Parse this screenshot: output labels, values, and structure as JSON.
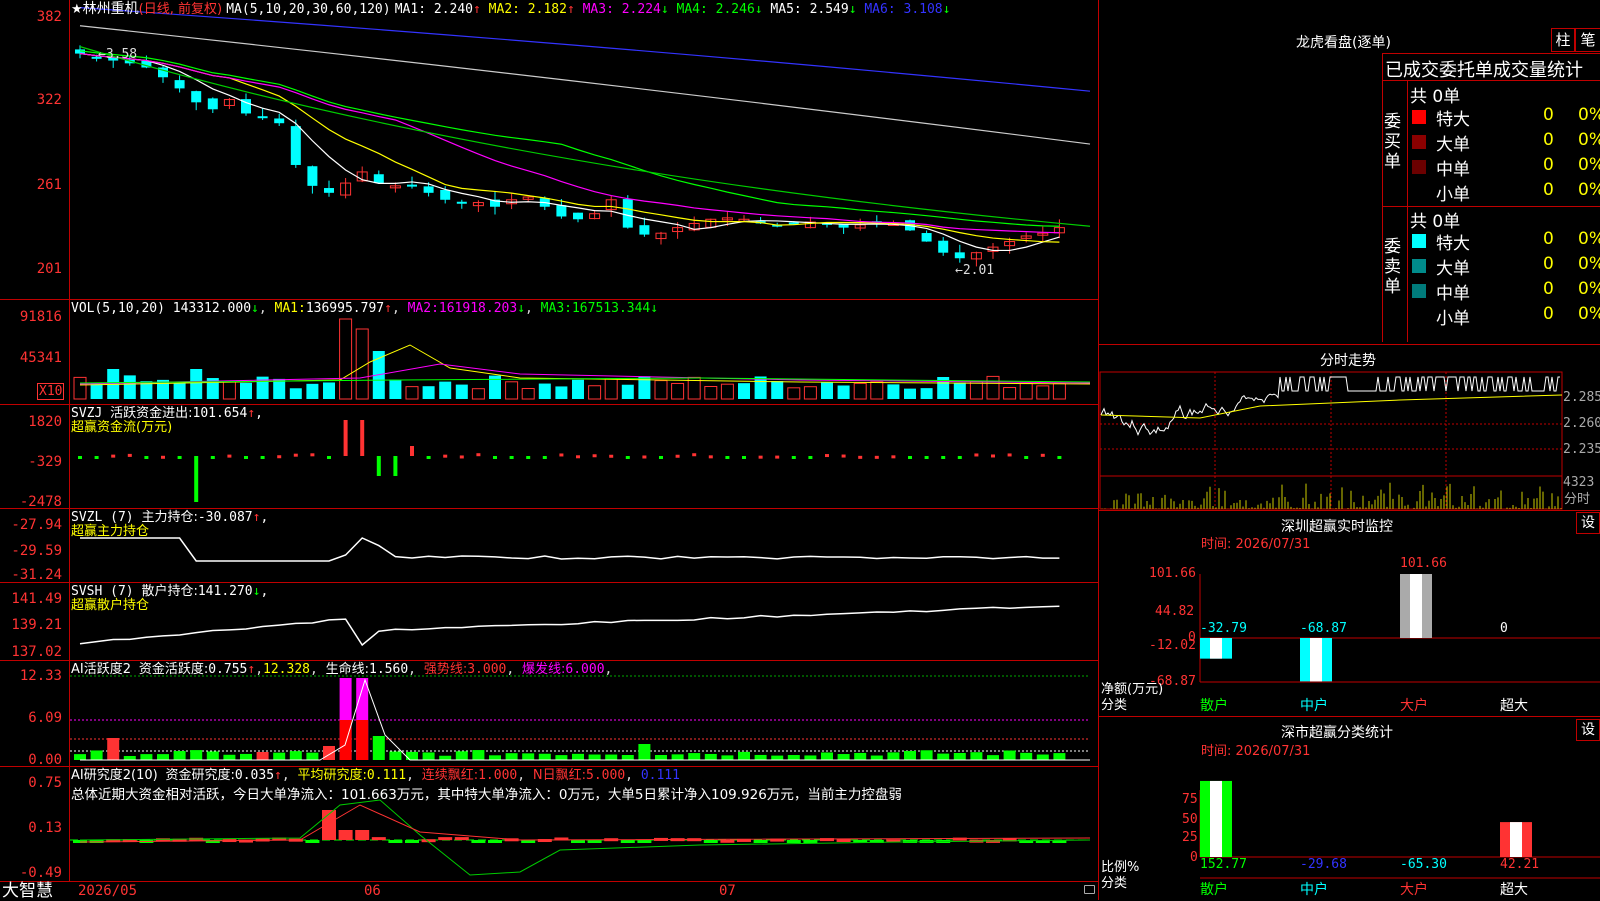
{
  "header": {
    "star": "★",
    "stock_name": "林州重机",
    "mode": "(日线, 前复权)",
    "ma_params": "MA(5,10,20,30,60,120)",
    "ma": [
      {
        "label": "MA1:",
        "value": "2.240",
        "arrow": "↑",
        "color": "#ffffff"
      },
      {
        "label": "MA2:",
        "value": "2.182",
        "arrow": "↑",
        "color": "#ffff00"
      },
      {
        "label": "MA3:",
        "value": "2.224",
        "arrow": "↓",
        "color": "#ff00ff"
      },
      {
        "label": "MA4:",
        "value": "2.246",
        "arrow": "↓",
        "color": "#00ff00"
      },
      {
        "label": "MA5:",
        "value": "2.549",
        "arrow": "↓",
        "color": "#ffffff"
      },
      {
        "label": "MA6:",
        "value": "3.108",
        "arrow": "↓",
        "color": "#3333ff"
      }
    ]
  },
  "price_axis": [
    "382",
    "322",
    "261",
    "201"
  ],
  "price_marks": {
    "high": "3.58",
    "low": "2.01"
  },
  "vol_panel": {
    "params": "VOL(5,10,20)",
    "vol": "143312.000",
    "vol_arrow": "↓",
    "ma1_label": "MA1:",
    "ma1": "136995.797",
    "ma1_arrow": "↑",
    "ma2_label": "MA2:",
    "ma2": "161918.203",
    "ma2_arrow": "↓",
    "ma3_label": "MA3:",
    "ma3": "167513.344",
    "ma3_arrow": "↓",
    "axis": [
      "91816",
      "45341"
    ],
    "unit": "X10"
  },
  "svzj_panel": {
    "name": "SVZJ",
    "label": "活跃资金进出:",
    "value": "101.654",
    "arrow": "↑",
    "comma": ",",
    "subtitle": "超赢资金流(万元)",
    "axis": [
      "1820",
      "-329",
      "-2478"
    ]
  },
  "svzl_panel": {
    "name": "SVZL",
    "param": "(7)",
    "label": "主力持仓:",
    "value": "-30.087",
    "arrow": "↑",
    "comma": ",",
    "subtitle": "超赢主力持仓",
    "axis": [
      "-27.94",
      "-29.59",
      "-31.24"
    ]
  },
  "svsh_panel": {
    "name": "SVSH",
    "param": "(7)",
    "label": "散户持仓:",
    "value": "141.270",
    "arrow": "↓",
    "comma": ",",
    "subtitle": "超赢散户持仓",
    "axis": [
      "141.49",
      "139.21",
      "137.02"
    ]
  },
  "ai_active_panel": {
    "name": "AI活跃度2",
    "label": "资金活跃度:",
    "value": "0.755",
    "arrow": "↑",
    "value2": "12.328",
    "life_label": "生命线:",
    "life_value": "1.560",
    "strong_label": "强势线:",
    "strong_value": "3.000",
    "burst_label": "爆发线:",
    "burst_value": "6.000",
    "axis": [
      "12.33",
      "6.09",
      "0.00"
    ]
  },
  "ai_research_panel": {
    "name": "AI研究度2(10)",
    "label": "资金研究度:",
    "value": "0.035",
    "arrow": "↑",
    "avg_label": "平均研究度:",
    "avg_value": "0.111",
    "cont_label": "连续飘红:",
    "cont_value": "1.000",
    "nday_label": "N日飘红:",
    "nday_value": "5.000",
    "last_value": "0.111",
    "summary": "总体近期大资金相对活跃，今日大单净流入：101.663万元，其中特大单净流入：0万元，大单5日累计净入109.926万元，当前主力控盘弱",
    "axis": [
      "0.75",
      "0.13",
      "-0.49"
    ]
  },
  "bottom_bar": {
    "brand": "大智慧",
    "dates": [
      "2026/05",
      "06",
      "07"
    ]
  },
  "right_panel": {
    "dragon_tiger_title": "龙虎看盘(逐单)",
    "btn_column": "柱",
    "btn_brush": "笔",
    "table_title": "已成交委托单成交量统计",
    "buy_label": "委买单",
    "sell_label": "委卖单",
    "buy_total": "共 0单",
    "sell_total": "共 0单",
    "buy_rows": [
      {
        "name": "特大",
        "count": "0",
        "pct": "0%",
        "color": "#ff0000"
      },
      {
        "name": "大单",
        "count": "0",
        "pct": "0%",
        "color": "#8b0000"
      },
      {
        "name": "中单",
        "count": "0",
        "pct": "0%",
        "color": "#6b0000"
      },
      {
        "name": "小单",
        "count": "0",
        "pct": "0%",
        "color": "#000000"
      }
    ],
    "sell_rows": [
      {
        "name": "特大",
        "count": "0",
        "pct": "0%",
        "color": "#00ffff"
      },
      {
        "name": "大单",
        "count": "0",
        "pct": "0%",
        "color": "#008b8b"
      },
      {
        "name": "中单",
        "count": "0",
        "pct": "0%",
        "color": "#007b7b"
      },
      {
        "name": "小单",
        "count": "0",
        "pct": "0%",
        "color": "#000000"
      }
    ],
    "intraday_title": "分时走势",
    "intraday_axis": [
      "2.285",
      "2.260",
      "2.235"
    ],
    "intraday_vol": "4323",
    "intraday_unit": "分时",
    "sz_monitor_title": "深圳超赢实时监控",
    "set_label": "设",
    "sz_time": "时间: 2026/07/31",
    "sz_axis": [
      "101.66",
      "44.82",
      "0",
      "-12.02",
      "-68.87"
    ],
    "sz_net_label": "净额(万元)",
    "sz_class_label": "分类",
    "sz_values": [
      "-32.79",
      "-68.87",
      "101.66",
      "0"
    ],
    "sz_categories": [
      "散户",
      "中户",
      "大户",
      "超大"
    ],
    "sz_stat_title": "深市超赢分类统计",
    "sz_stat_time": "时间: 2026/07/31",
    "sz_stat_axis": [
      "75",
      "50",
      "25",
      "0"
    ],
    "ratio_label": "比例%",
    "ratio_class_label": "分类",
    "stat_values": [
      "152.77",
      "-29.68",
      "-65.30",
      "42.21"
    ],
    "stat_categories": [
      "散户",
      "中户",
      "大户",
      "超大"
    ]
  },
  "chart_data": [
    {
      "type": "bar",
      "title": "深圳超赢实时监控",
      "categories": [
        "散户",
        "中户",
        "大户",
        "超大"
      ],
      "values": [
        -32.79,
        -68.87,
        101.66,
        0
      ],
      "ylabel": "净额(万元)",
      "ylim": [
        -68.87,
        101.66
      ]
    },
    {
      "type": "bar",
      "title": "深市超赢分类统计",
      "categories": [
        "散户",
        "中户",
        "大户",
        "超大"
      ],
      "values": [
        152.77,
        -29.68,
        -65.3,
        42.21
      ],
      "ylabel": "比例%",
      "ylim": [
        0,
        75
      ]
    }
  ]
}
